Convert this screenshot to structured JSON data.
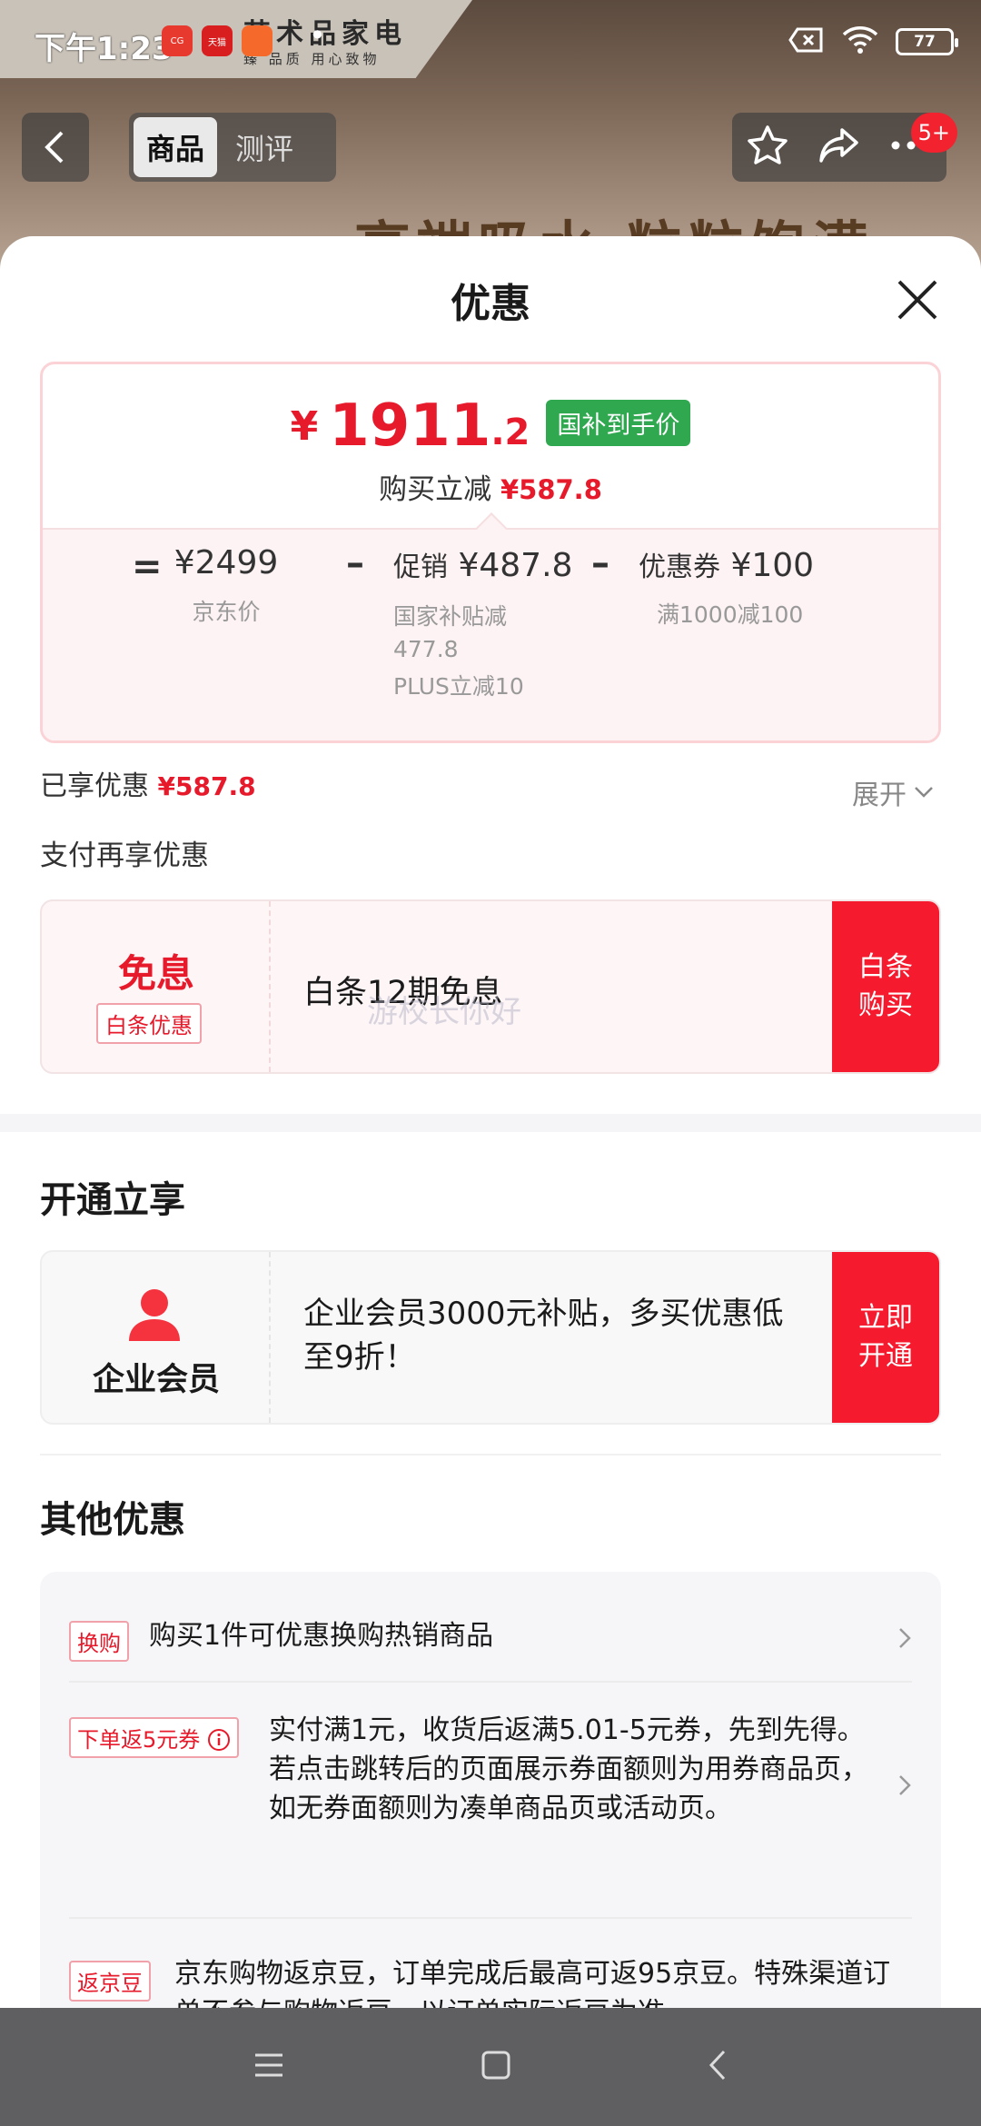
{
  "status_bar": {
    "time": "下午1:23",
    "app_icons": [
      {
        "name": "app-icon-1",
        "color": "#e8392f",
        "label": "CG"
      },
      {
        "name": "app-icon-2",
        "color": "#d81e1e",
        "label": "天猫"
      },
      {
        "name": "app-icon-3",
        "color": "#f56a2a",
        "label": ""
      }
    ],
    "dots": "•",
    "battery": "77"
  },
  "background": {
    "banner_title": "艺术品家电",
    "banner_sub": "臻 品质  用心致物",
    "product_headline": "高端吸水 粒粒饱满"
  },
  "nav": {
    "tabs": [
      {
        "label": "商品",
        "active": true
      },
      {
        "label": "测评",
        "active": false
      }
    ],
    "badge": "5+"
  },
  "sheet": {
    "title": "优惠",
    "price_card": {
      "yen": "¥",
      "price_int": "1911",
      "price_dec": ".2",
      "price_tag": "国补到手价",
      "instant_label": "购买立减",
      "instant_value": "¥587.8",
      "breakdown": {
        "equals": "=",
        "base_value": "¥2499",
        "base_caption": "京东价",
        "minus1": "–",
        "promo_label": "促销",
        "promo_value": "¥487.8",
        "promo_caption1": "国家补贴减",
        "promo_caption2": "477.8",
        "promo_caption3": "PLUS立减10",
        "minus2": "–",
        "coupon_label": "优惠券",
        "coupon_value": "¥100",
        "coupon_caption": "满1000减100"
      }
    },
    "enjoyed_label": "已享优惠",
    "enjoyed_value": "¥587.8",
    "expand_label": "展开",
    "pay_more": "支付再享优惠",
    "baitiao": {
      "big": "免息",
      "tag": "白条优惠",
      "text": "白条12期免息",
      "button": "白条购买"
    },
    "watermark": "游校长你好",
    "open_section_title": "开通立享",
    "member": {
      "label": "企业会员",
      "text": "企业会员3000元补贴，多买优惠低至9折！",
      "button": "立即开通"
    },
    "other_section_title": "其他优惠",
    "other_items": [
      {
        "tag": "换购",
        "text": "购买1件可优惠换购热销商品"
      },
      {
        "tag": "下单返5元券",
        "text": "实付满1元，收货后返满5.01-5元券，先到先得。若点击跳转后的页面展示券面额则为用券商品页，如无券面额则为凑单商品页或活动页。"
      },
      {
        "tag": "返京豆",
        "text": "京东购物返京豆，订单完成后最高可返95京豆。特殊渠道订单不参与购物返豆，以订单实际返豆为准。"
      }
    ]
  },
  "colors": {
    "accent_red": "#e61a2b",
    "button_red": "#f51a2e",
    "tag_green": "#2fa84f"
  }
}
